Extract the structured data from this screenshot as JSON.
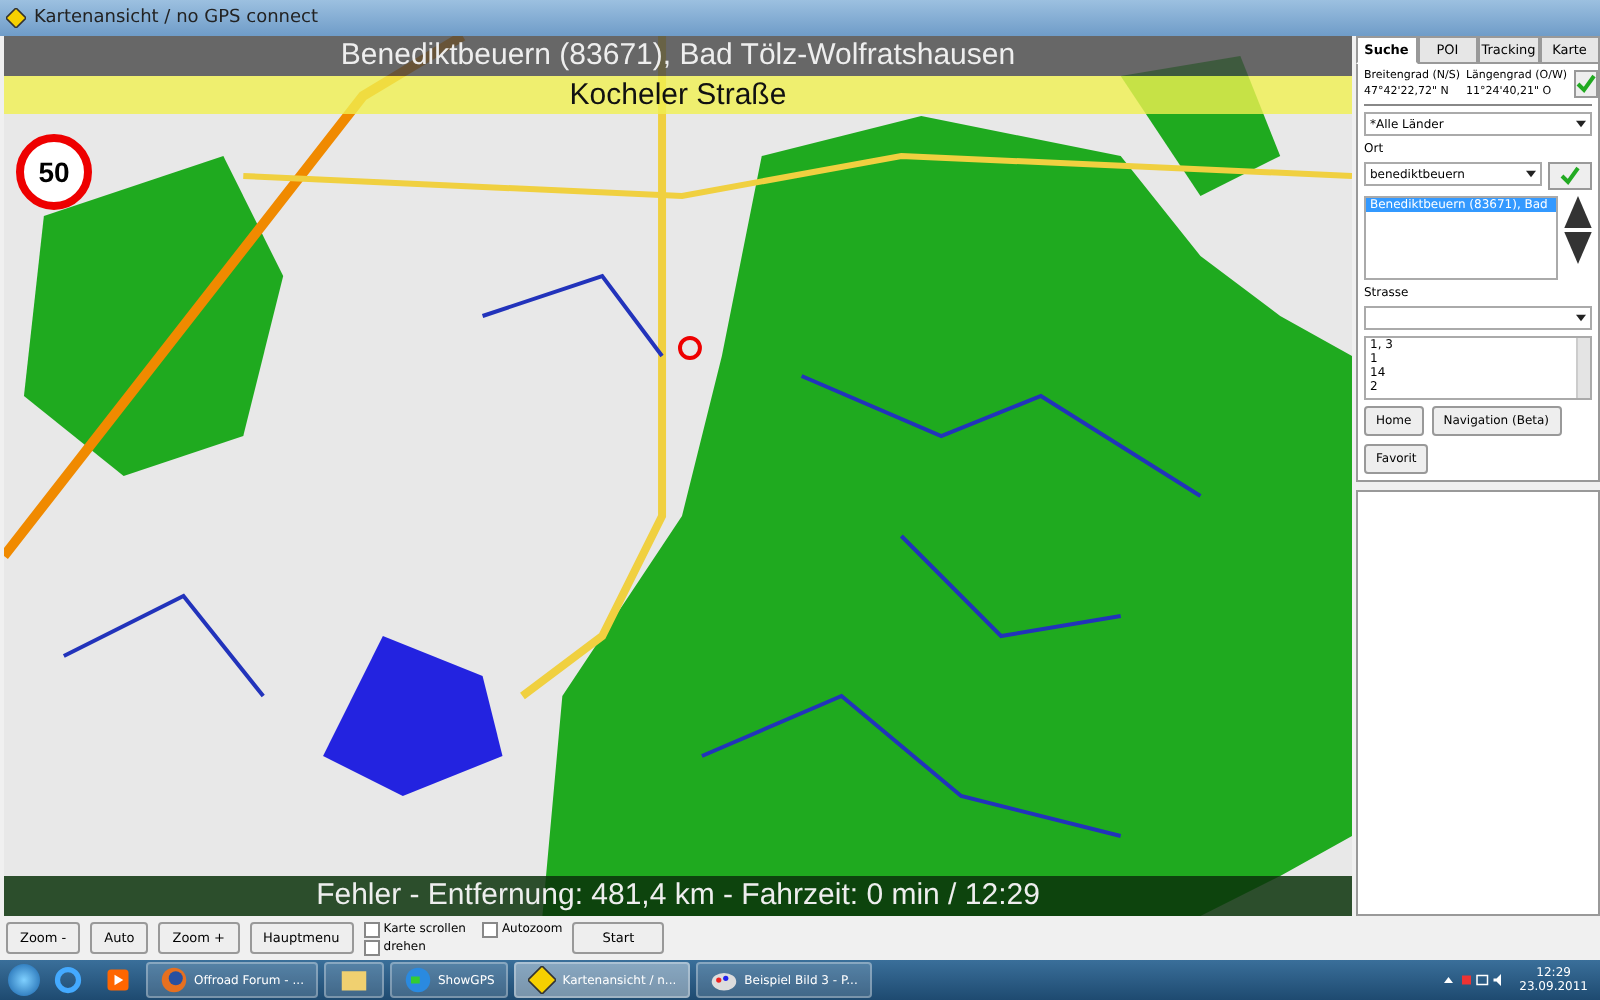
{
  "window": {
    "title": "Kartenansicht / no GPS connect"
  },
  "map": {
    "location_title": "Benediktbeuern (83671), Bad Tölz-Wolfratshausen",
    "street": "Kocheler Straße",
    "speed_limit": "50",
    "status": "Fehler - Entfernung: 481,4 km - Fahrzeit: 0 min / 12:29"
  },
  "tabs": [
    {
      "label": "Suche",
      "selected": true
    },
    {
      "label": "POI",
      "selected": false
    },
    {
      "label": "Tracking",
      "selected": false
    },
    {
      "label": "Karte",
      "selected": false
    }
  ],
  "coordinates": {
    "lat_label": "Breitengrad (N/S)",
    "lon_label": "Längengrad (O/W)",
    "lat_value": "47°42'22,72\" N",
    "lon_value": "11°24'40,21\" O"
  },
  "country": {
    "value": "*Alle Länder"
  },
  "place": {
    "label": "Ort",
    "value": "benediktbeuern",
    "results": [
      {
        "text": "Benediktbeuern (83671), Bad",
        "selected": true
      }
    ]
  },
  "street_search": {
    "label": "Strasse",
    "results": [
      {
        "text": "1, 3",
        "selected": false
      },
      {
        "text": "1",
        "selected": false
      },
      {
        "text": "14",
        "selected": false
      },
      {
        "text": "2",
        "selected": false
      }
    ]
  },
  "panel_buttons": [
    "Home",
    "Navigation (Beta)",
    "Favorit"
  ],
  "toolbar": {
    "buttons": [
      "Zoom -",
      "Auto",
      "Zoom +",
      "Hauptmenu"
    ],
    "checkboxes": [
      {
        "label": "Karte scrollen",
        "checked": false
      },
      {
        "label": "Autozoom",
        "checked": false
      },
      {
        "label": "drehen",
        "checked": false
      }
    ],
    "start": "Start"
  },
  "taskbar": {
    "tasks": [
      {
        "label": "Offroad Forum - ...",
        "kind": "browser",
        "selected": false
      },
      {
        "kind": "folder",
        "selected": false
      },
      {
        "label": "ShowGPS",
        "kind": "globe",
        "selected": false
      },
      {
        "label": "Kartenansicht / n...",
        "kind": "sign",
        "selected": true
      },
      {
        "label": "Beispiel Bild 3 - P...",
        "kind": "paint",
        "selected": false
      }
    ],
    "time": "12:29",
    "date": "23.09.2011"
  }
}
